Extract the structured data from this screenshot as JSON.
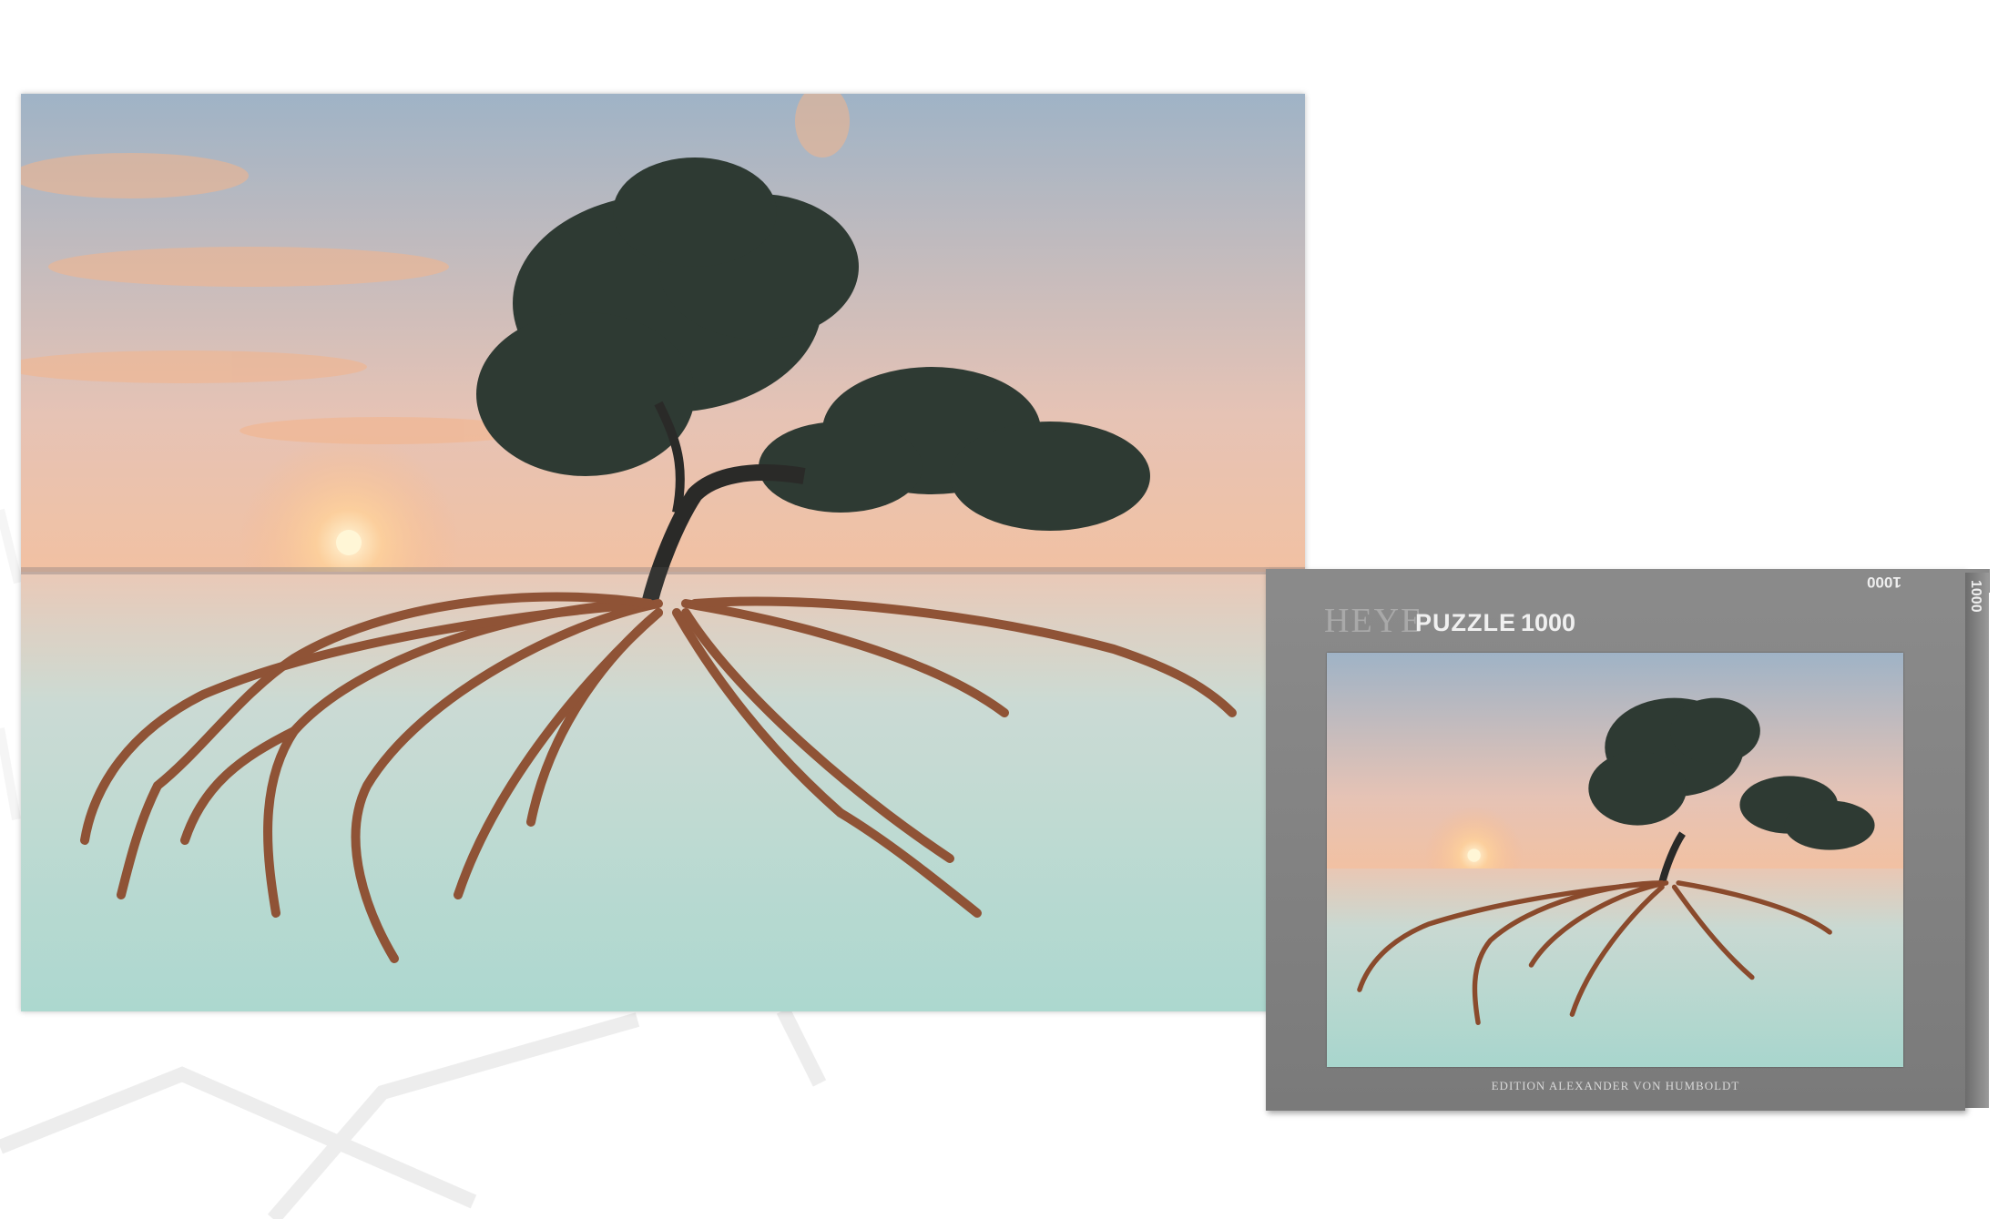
{
  "box": {
    "brand": "HEYE",
    "title": "PUZZLE",
    "piece_count": "1000",
    "edition": "EDITION ALEXANDER VON HUMBOLDT",
    "side_label": "1000",
    "top_label": "1000"
  },
  "colors": {
    "sky_top": "#9fb3c6",
    "sky_mid": "#f3c6a8",
    "sun": "#fff3d0",
    "water": "#b9ddd5",
    "roots": "#8a4a2c",
    "box_gray": "#8b8b8b"
  }
}
